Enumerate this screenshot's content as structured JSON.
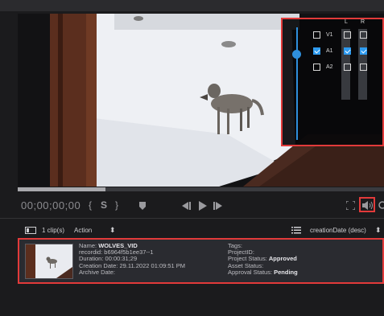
{
  "transport": {
    "timecode": "00;00;00;00",
    "mark_in": "{",
    "split": "S",
    "mark_out": "}",
    "progress": 0.24
  },
  "audio": {
    "col_left": "L",
    "col_right": "R",
    "rows": [
      {
        "label": "V1",
        "checked": false,
        "left": false,
        "right": false
      },
      {
        "label": "A1",
        "checked": true,
        "left": true,
        "right": true
      },
      {
        "label": "A2",
        "checked": false,
        "left": false,
        "right": false
      }
    ],
    "volume": 0.76,
    "accent": "#2f8fdc",
    "highlight": "#e23a3a"
  },
  "clips": {
    "count_label": "1 clip(s)",
    "action_label": "Action",
    "sort_label": "creationDate (desc)"
  },
  "clip": {
    "name_label": "Name:",
    "name": "WOLVES_VID",
    "record_label": "recordid:",
    "record": "b6964f5b1ee37--1",
    "duration_label": "Duration:",
    "duration": "00:00:31;29",
    "created_label": "Creation Date:",
    "created": "29.11.2022 01:09:51 PM",
    "archive_label": "Archive Date:",
    "archive": "",
    "tags_label": "Tags:",
    "tags": "",
    "project_label": "ProjectID:",
    "project": "",
    "pstatus_label": "Project Status:",
    "pstatus": "Approved",
    "astatus_label": "Asset Status:",
    "astatus": "",
    "approval_label": "Approval Status:",
    "approval": "Pending"
  }
}
